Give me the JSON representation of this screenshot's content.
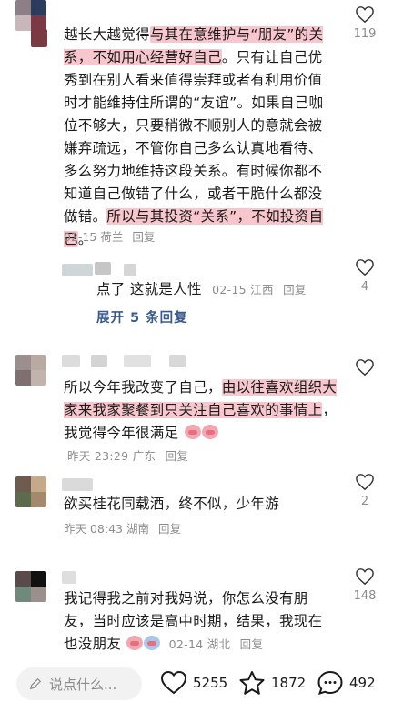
{
  "comments": [
    {
      "text_parts": [
        "越长大越觉得",
        "与其在意维护与“朋友”的关系，不如用心经营好自己",
        "。只有让自己优秀到在别人看来值得崇拜或者有利用价值时才能维持住所谓的“友谊”。如果自己咖位不够大，只要稍微不顺别人的意就会被嫌弃疏远，不管你自己多么认真地看待、多么努力地维持这段关系。有时候你都不知道自己做错了什么，或者干脆什么都没做错。",
        "所以与其投资“关系”，不如投资自己",
        "。"
      ],
      "date": "02-15",
      "location": "荷兰",
      "reply": "回复",
      "likes": "119"
    },
    {
      "text": "点了 这就是人性",
      "date": "02-15",
      "location": "江西",
      "reply": "回复",
      "likes": "4"
    },
    {
      "text_parts": [
        "所以今年我改变了自己，",
        "由以往喜欢组织大家来我家聚餐到只关注自己喜欢的事情上",
        "，我觉得今年很满足"
      ],
      "date": "昨天 23:29",
      "location": "广东",
      "reply": "回复",
      "likes": ""
    },
    {
      "text": "欲买桂花同载酒，终不似，少年游",
      "date": "昨天 08:43",
      "location": "湖南",
      "reply": "回复",
      "likes": "2"
    },
    {
      "text": "我记得我之前对我妈说，你怎么没有朋友，当时应该是高中时期，结果，我现在也没朋友",
      "date": "02-14",
      "location": "湖北",
      "reply": "回复",
      "likes": "148"
    }
  ],
  "expand_label": "展开 5 条回复",
  "bottom": {
    "input_placeholder": "说点什么...",
    "like_count": "5255",
    "fav_count": "1872",
    "comment_count": "492",
    "icons": [
      "pencil-icon",
      "heart-icon",
      "star-icon",
      "chat-bubble-icon"
    ]
  },
  "colors": {
    "highlight": "#f7c7cd",
    "meta_gray": "#8c8c8c",
    "expand_blue": "#3a5a8c"
  }
}
